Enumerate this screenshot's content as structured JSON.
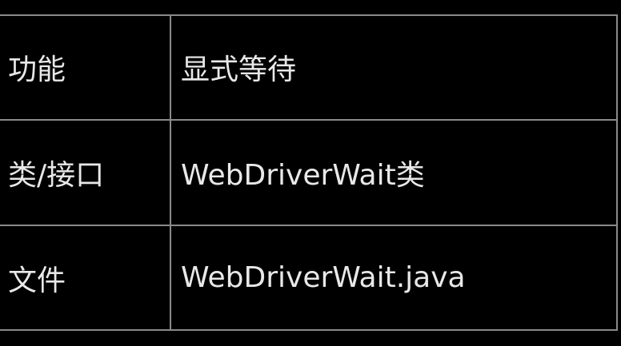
{
  "table": {
    "rows": [
      {
        "label": "功能",
        "value": "显式等待"
      },
      {
        "label": "类/接口",
        "value": "WebDriverWait类"
      },
      {
        "label": "文件",
        "value": "WebDriverWait.java"
      }
    ]
  }
}
